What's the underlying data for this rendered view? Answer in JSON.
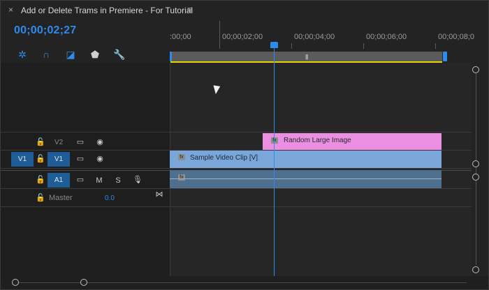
{
  "title": "Add or Delete Trams in Premiere - For Tutorial",
  "title_bar": {
    "close_icon": "close-icon",
    "menu_icon": "hamburger-menu-icon"
  },
  "timecode": "00;00;02;27",
  "tools": [
    {
      "name": "snap-icon"
    },
    {
      "name": "linked-selection-icon"
    },
    {
      "name": "add-marker-icon"
    },
    {
      "name": "marker-icon"
    },
    {
      "name": "wrench-icon"
    }
  ],
  "ruler": {
    "labels": [
      ":00;00",
      "00;00;02;00",
      "00;00;04;00",
      "00;00;06;00",
      "00;00;08;0"
    ]
  },
  "tracks": {
    "v2": {
      "label": "V2"
    },
    "v1": {
      "source": "V1",
      "label": "V1"
    },
    "a1": {
      "label": "A1",
      "m": "M",
      "s": "S"
    },
    "master": {
      "label": "Master",
      "value": "0.0"
    }
  },
  "clips": {
    "pink": {
      "name": "Random Large Image",
      "fx": "fx"
    },
    "blue": {
      "name": "Sample Video Clip [V]",
      "fx": "fx"
    },
    "audio": {
      "fx": "fx"
    }
  },
  "colors": {
    "accent": "#2d8ceb",
    "clip_pink": "#ea8fe2",
    "clip_blue": "#7aa6d9",
    "clip_audio": "#4f6f8e",
    "work_area": "#e9d500"
  },
  "playhead_time": "00;00;02;27"
}
